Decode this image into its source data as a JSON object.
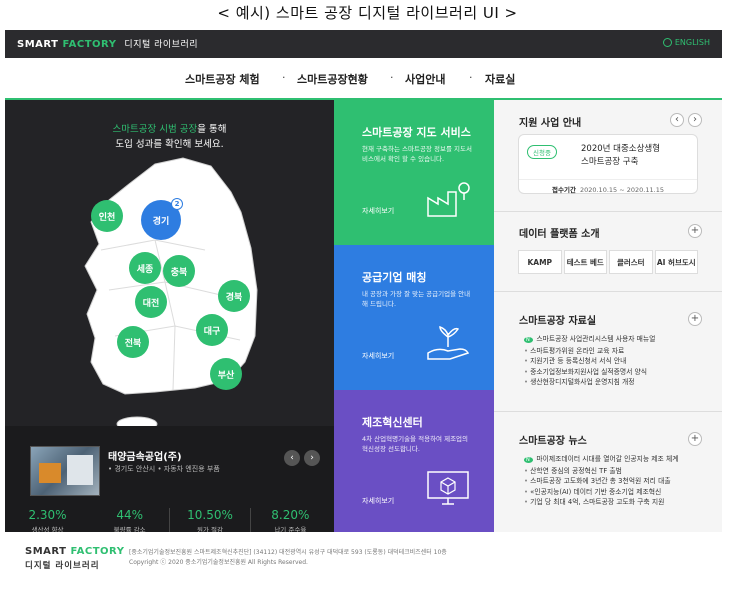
{
  "caption": "< 예시) 스마트 공장 디지털 라이브러리 UI >",
  "topbar": {
    "logo_smart": "SMART",
    "logo_factory": "FACTORY",
    "logo_sub": "디지털 라이브러리",
    "lang": "ENGLISH"
  },
  "nav": {
    "items": [
      "스마트공장 체험",
      "스마트공장현황",
      "사업안내",
      "자료실"
    ],
    "separator": "·"
  },
  "map": {
    "title_highlight": "스마트공장 시범 공장",
    "title_rest": "을 통해",
    "title_line2": "도입 성과를 확인해 보세요.",
    "regions": [
      "인천",
      "경기",
      "세종",
      "충북",
      "대전",
      "경북",
      "전북",
      "대구",
      "부산"
    ],
    "gyeonggi_badge": "2"
  },
  "company": {
    "name": "태양금속공업(주)",
    "tags": "• 경기도 안산시   • 자동차 엔진용 부품",
    "prev_arrow": "‹",
    "next_arrow": "›",
    "stats": [
      {
        "value": "2.30%",
        "label": "생산성 향상"
      },
      {
        "value": "44%",
        "label": "불량률 감소"
      },
      {
        "value": "10.50%",
        "label": "원가 절감"
      },
      {
        "value": "8.20%",
        "label": "납기 준수율"
      }
    ]
  },
  "cards": [
    {
      "title": "스마트공장 지도 서비스",
      "desc": "현재 구축하는 스마트공장 정보를 지도서비스에서 확인 할 수 있습니다.",
      "more": "자세히보기",
      "color": "#2fbf71",
      "icon": "factory-location-icon"
    },
    {
      "title": "공급기업 매칭",
      "desc": "내 공장과 가장 잘 맞는 공급기업을 안내해 드립니다.",
      "more": "자세히보기",
      "color": "#2e7de1",
      "icon": "hand-plant-icon"
    },
    {
      "title": "제조혁신센터",
      "desc": "4차 산업혁명기술을 적용하여 제조업의 혁신성장 선도합니다.",
      "more": "자세히보기",
      "color": "#6a4fc4",
      "icon": "monitor-cube-icon"
    }
  ],
  "support": {
    "title": "지원 사업 안내",
    "prev_arrow": "‹",
    "next_arrow": "›",
    "badge": "신청중",
    "name_line1": "2020년 대중소상생형",
    "name_line2": "스마트공장 구축",
    "period_label": "접수기간",
    "period": "2020.10.15 ~ 2020.11.15"
  },
  "platform": {
    "title": "데이터 플랫폼 소개",
    "plus": "+",
    "items": [
      "KAMP",
      "테스트 베드",
      "클러스터",
      "AI 허브도시"
    ]
  },
  "library": {
    "title": "스마트공장 자료실",
    "plus": "+",
    "items": [
      "스마트공장 사업관리시스템 사용자 매뉴얼",
      "스마트평가위원 온라인 교육 자료",
      "지원기관 등 등록신청서 서식 안내",
      "중소기업정보화지원사업 실적증명서 양식",
      "생산현장디지털화사업 운영지침 개정"
    ]
  },
  "news": {
    "title": "스마트공장 뉴스",
    "plus": "+",
    "items": [
      "마이제조데이터 시대를 열어갈 인공지능 제조 체계",
      "산학연 중심의 공정혁신 TF 출범",
      "스마트공장 고도화에 3년간 총 3천억원 저리 대출",
      "«인공지능(AI) 데이터 기반 중소기업 제조혁신",
      "기업 당 최대 4억, 스마트공장 고도화 구축 지원"
    ]
  },
  "footer": {
    "logo_smart": "SMART",
    "logo_factory": "FACTORY",
    "logo_sub": "디지털 라이브러리",
    "info_line1": "[중소기업기술정보진흥원 스마트제조혁신추진단] (34112) 대전광역시 유성구 대덕대로 593 (도룡동) 대덕테크비즈센터 10층",
    "info_line2": "Copyright ⓒ 2020 중소기업기술정보진흥원 All Rights Reserved."
  }
}
